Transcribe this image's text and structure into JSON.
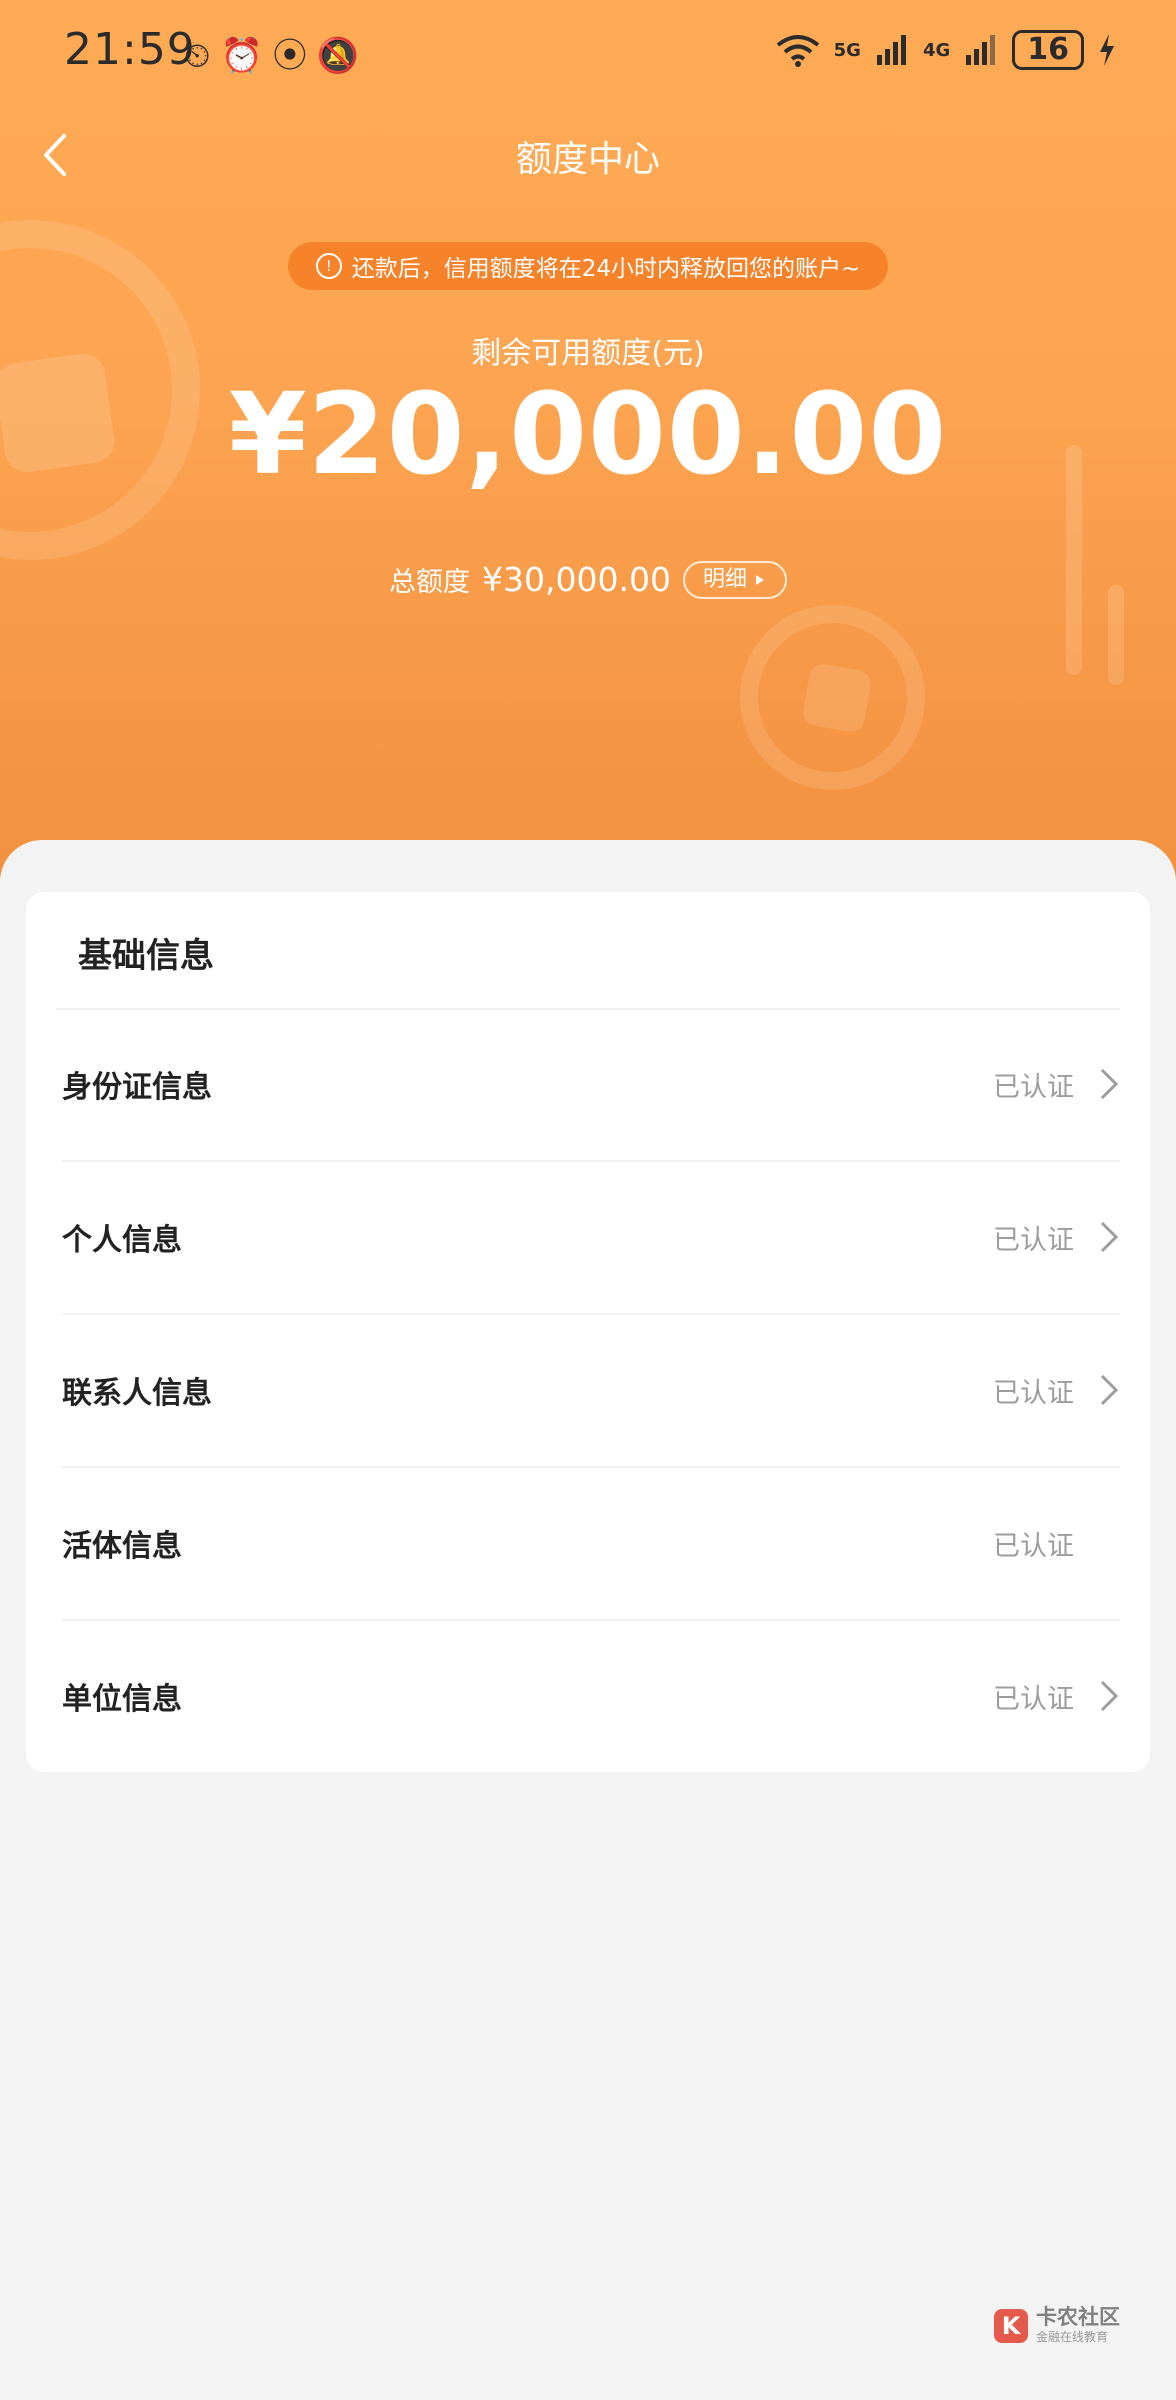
{
  "status_bar": {
    "time": "21:59",
    "left_icons": "⏲⏰⦿🔕",
    "net1": "5G",
    "net2": "4G",
    "battery": "16"
  },
  "header": {
    "title": "额度中心"
  },
  "notice": {
    "icon": "!",
    "text": "还款后，信用额度将在24小时内释放回您的账户~"
  },
  "credit": {
    "available_label": "剩余可用额度(元)",
    "available_amount": "¥20,000.00",
    "total_label": "总额度",
    "total_amount": "¥30,000.00",
    "detail_label": "明细"
  },
  "basic_info": {
    "title": "基础信息",
    "items": [
      {
        "label": "身份证信息",
        "status": "已认证",
        "has_arrow": true
      },
      {
        "label": "个人信息",
        "status": "已认证",
        "has_arrow": true
      },
      {
        "label": "联系人信息",
        "status": "已认证",
        "has_arrow": true
      },
      {
        "label": "活体信息",
        "status": "已认证",
        "has_arrow": false
      },
      {
        "label": "单位信息",
        "status": "已认证",
        "has_arrow": true
      }
    ]
  },
  "watermark": {
    "logo": "K",
    "name": "卡农社区",
    "sub": "金融在线教育"
  }
}
